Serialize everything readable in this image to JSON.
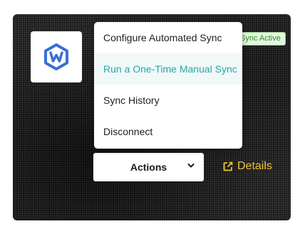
{
  "integration": {
    "logo_icon": "wrike-w-logo-icon",
    "logo_color": "#3b6fd8",
    "status_badge": "Sync Active"
  },
  "menu": {
    "items": [
      {
        "label": "Configure Automated Sync",
        "highlighted": false
      },
      {
        "label": "Run a One-Time Manual Sync",
        "highlighted": true
      },
      {
        "label": "Sync History",
        "highlighted": false
      },
      {
        "label": "Disconnect",
        "highlighted": false
      }
    ],
    "highlight_color": "#2aa6a4"
  },
  "actions_button": {
    "label": "Actions",
    "icon": "chevron-down-icon"
  },
  "details_link": {
    "label": "Details",
    "icon": "external-link-icon",
    "color": "#f2c233"
  }
}
